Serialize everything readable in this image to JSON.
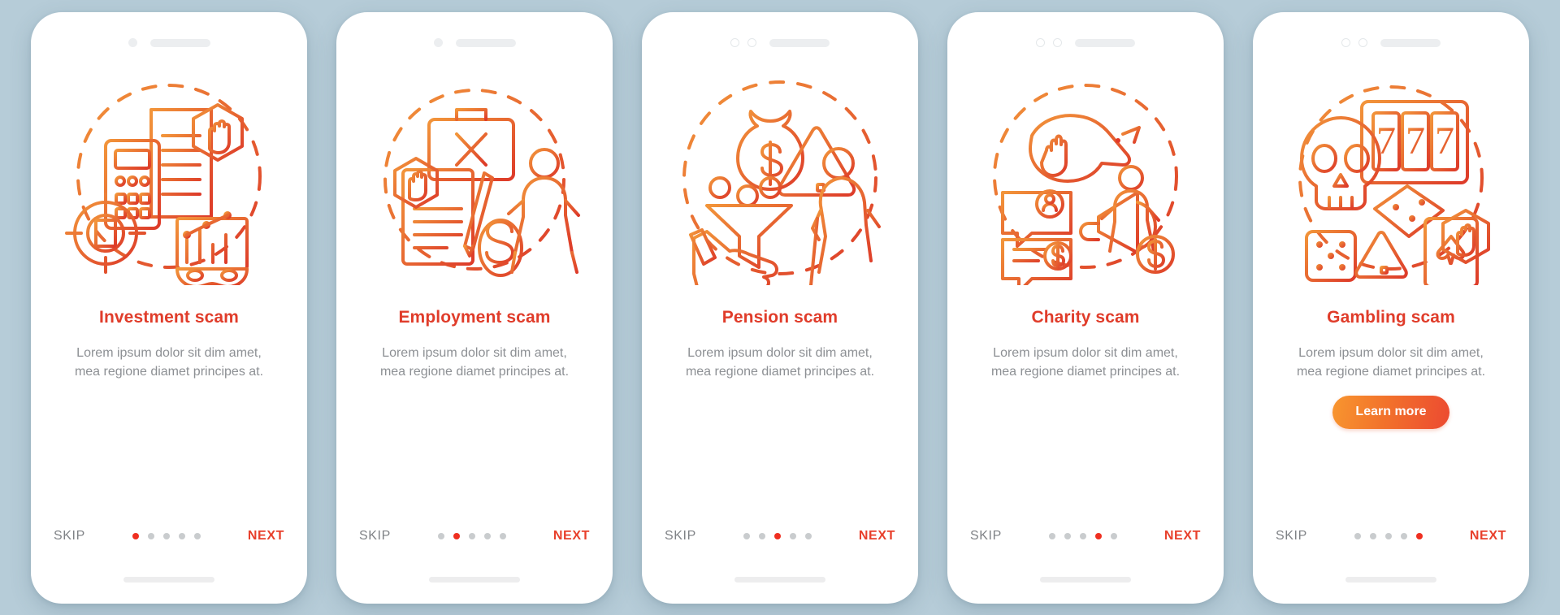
{
  "theme": {
    "background": "#b6ccd8",
    "card_background": "#ffffff",
    "title_color": "#e03c2a",
    "body_color": "#8d9094",
    "next_color": "#e8402c",
    "skip_color": "#7f8286",
    "dot_active_color": "#ef2f20",
    "dot_inactive_color": "#c9ccce",
    "illustration_stroke_start": "#f08b33",
    "illustration_stroke_end": "#e1392a",
    "button_gradient_start": "#f8962f",
    "button_gradient_end": "#ec4a31"
  },
  "common": {
    "skip_label": "SKIP",
    "next_label": "NEXT",
    "body_text": "Lorem ipsum dolor sit dim amet, mea regione diamet principes at.",
    "total_steps": 5
  },
  "screens": [
    {
      "id": "investment-scam",
      "title": "Investment scam",
      "body": "Lorem ipsum dolor sit dim amet, mea regione diamet principes at.",
      "skip_label": "SKIP",
      "next_label": "NEXT",
      "active_step": 1,
      "has_learn_more": false,
      "learn_more_label": "",
      "camera_style": "dot",
      "illustration": "investment-scam-illustration"
    },
    {
      "id": "employment-scam",
      "title": "Employment scam",
      "body": "Lorem ipsum dolor sit dim amet, mea regione diamet principes at.",
      "skip_label": "SKIP",
      "next_label": "NEXT",
      "active_step": 2,
      "has_learn_more": false,
      "learn_more_label": "",
      "camera_style": "dot",
      "illustration": "employment-scam-illustration"
    },
    {
      "id": "pension-scam",
      "title": "Pension scam",
      "body": "Lorem ipsum dolor sit dim amet, mea regione diamet principes at.",
      "skip_label": "SKIP",
      "next_label": "NEXT",
      "active_step": 3,
      "has_learn_more": false,
      "learn_more_label": "",
      "camera_style": "rings",
      "illustration": "pension-scam-illustration"
    },
    {
      "id": "charity-scam",
      "title": "Charity scam",
      "body": "Lorem ipsum dolor sit dim amet, mea regione diamet principes at.",
      "skip_label": "SKIP",
      "next_label": "NEXT",
      "active_step": 4,
      "has_learn_more": false,
      "learn_more_label": "",
      "camera_style": "rings",
      "illustration": "charity-scam-illustration"
    },
    {
      "id": "gambling-scam",
      "title": "Gambling scam",
      "body": "Lorem ipsum dolor sit dim amet, mea regione diamet principes at.",
      "skip_label": "SKIP",
      "next_label": "NEXT",
      "active_step": 5,
      "has_learn_more": true,
      "learn_more_label": "Learn more",
      "camera_style": "rings",
      "illustration": "gambling-scam-illustration"
    }
  ]
}
